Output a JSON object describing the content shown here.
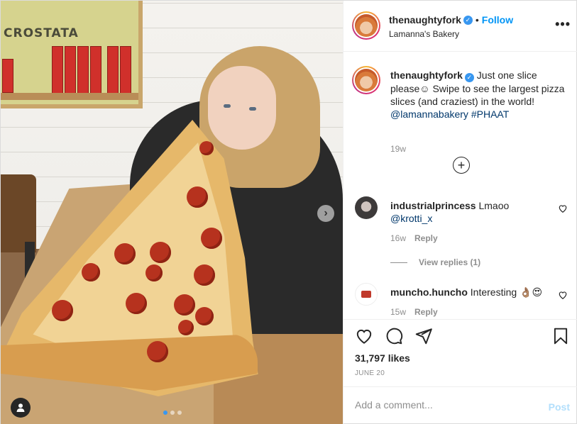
{
  "post": {
    "author": "thenaughtyfork",
    "location": "Lamanna's Bakery",
    "follow_label": "Follow",
    "separator": "•",
    "more_label": "•••"
  },
  "photo": {
    "poster_text": "CROSTATA",
    "next_label": "›",
    "carousel_count": 3,
    "active_slide": 1
  },
  "caption": {
    "username": "thenaughtyfork",
    "text": "Just one slice please☺ Swipe to see the largest pizza slices (and craziest) in the world!",
    "mention": "@lamannabakery",
    "hashtag": "#PHAAT",
    "time": "19w"
  },
  "load_more_label": "+",
  "comments": [
    {
      "username": "industrialprincess",
      "text": "Lmaoo",
      "mention": "@krotti_x",
      "time": "16w",
      "reply_label": "Reply",
      "view_replies": "View replies (1)"
    },
    {
      "username": "muncho.huncho",
      "text": "Interesting 👌🏽😍",
      "time": "15w",
      "reply_label": "Reply"
    }
  ],
  "likes": "31,797 likes",
  "date": "JUNE 20",
  "add_comment": {
    "placeholder": "Add a comment...",
    "post_label": "Post"
  },
  "colors": {
    "link": "#00376b",
    "follow": "#0095f6",
    "verified": "#3897f0",
    "post_disabled": "#b2dffc"
  },
  "icons": [
    "heart-icon",
    "comment-icon",
    "share-icon",
    "bookmark-icon",
    "more-icon",
    "user-tag-icon",
    "verified-icon",
    "chevron-right-icon",
    "plus-circle-icon"
  ]
}
